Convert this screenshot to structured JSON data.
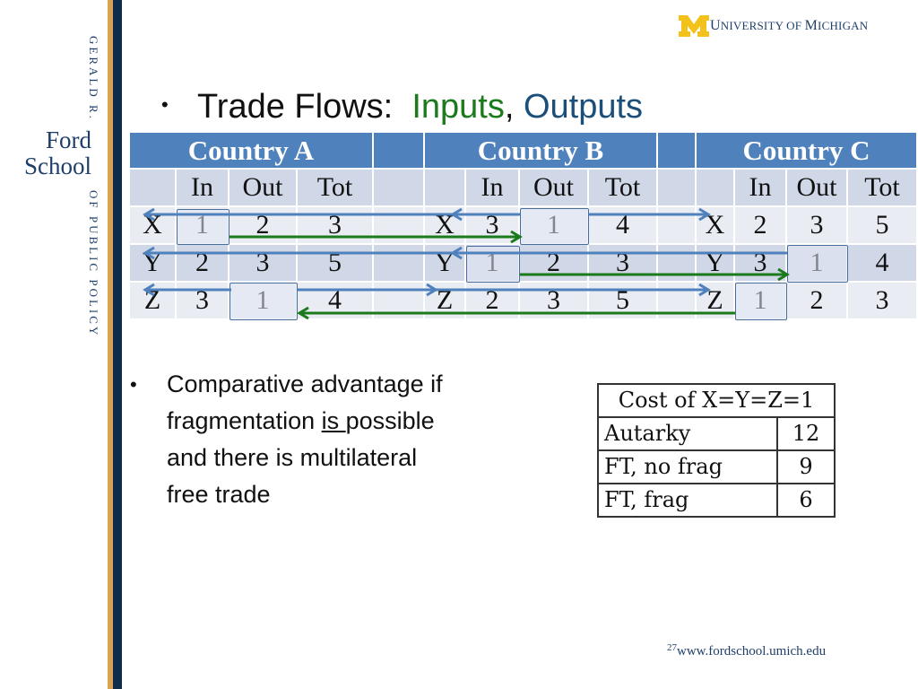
{
  "branding": {
    "sidebar_top": "GERALD R.",
    "sidebar_logo_line1": "Ford",
    "sidebar_logo_line2": "School",
    "sidebar_bottom": "OF PUBLIC POLICY",
    "university_first_letter": "U",
    "university_rest": "NIVERSITY OF ",
    "university_m_letter": "M",
    "university_end": "ICHIGAN",
    "gold": "#d8a454",
    "navy": "#0f2c4a",
    "maize": "#f2c21b"
  },
  "title": {
    "bullet": "•",
    "prefix": "Trade Flows:",
    "inputs_word": "Inputs",
    "comma": ",",
    "outputs_word": "Outputs",
    "inputs_color": "#1b7a1b",
    "outputs_color": "#1b4f7a"
  },
  "trade_table": {
    "countries": [
      {
        "name": "Country A",
        "columns": [
          "In",
          "Out",
          "Tot"
        ],
        "rows": [
          {
            "good": "X",
            "in": "1",
            "out": "2",
            "tot": "3"
          },
          {
            "good": "Y",
            "in": "2",
            "out": "3",
            "tot": "5"
          },
          {
            "good": "Z",
            "in": "3",
            "out": "1",
            "tot": "4"
          }
        ]
      },
      {
        "name": "Country B",
        "columns": [
          "In",
          "Out",
          "Tot"
        ],
        "rows": [
          {
            "good": "X",
            "in": "3",
            "out": "1",
            "tot": "4"
          },
          {
            "good": "Y",
            "in": "1",
            "out": "2",
            "tot": "3"
          },
          {
            "good": "Z",
            "in": "2",
            "out": "3",
            "tot": "5"
          }
        ]
      },
      {
        "name": "Country C",
        "columns": [
          "In",
          "Out",
          "Tot"
        ],
        "rows": [
          {
            "good": "X",
            "in": "2",
            "out": "3",
            "tot": "5"
          },
          {
            "good": "Y",
            "in": "3",
            "out": "1",
            "tot": "4"
          },
          {
            "good": "Z",
            "in": "1",
            "out": "2",
            "tot": "3"
          }
        ]
      }
    ],
    "highlighted_cells": [
      "Country A X In",
      "Country A Z Out",
      "Country B X Out",
      "Country B Y In",
      "Country C Y Out",
      "Country C Z In"
    ],
    "header_color": "#4f81bd",
    "input_arrow_color": "#1b7a1b",
    "output_arrow_color": "#4f81bd"
  },
  "body": {
    "bullet": "•",
    "line1": "Comparative advantage if",
    "line2_before": "fragmentation ",
    "line2_underlined": "is ",
    "line2_after": "possible",
    "line3": "and there is multilateral",
    "line4": "free trade"
  },
  "cost_table": {
    "header": "Cost of X=Y=Z=1",
    "rows": [
      {
        "label": "Autarky",
        "value": "12"
      },
      {
        "label": "FT, no frag",
        "value": "9"
      },
      {
        "label": "FT, frag",
        "value": "6"
      }
    ]
  },
  "footer": {
    "page_number": "27",
    "url": "www.fordschool.umich.edu"
  }
}
